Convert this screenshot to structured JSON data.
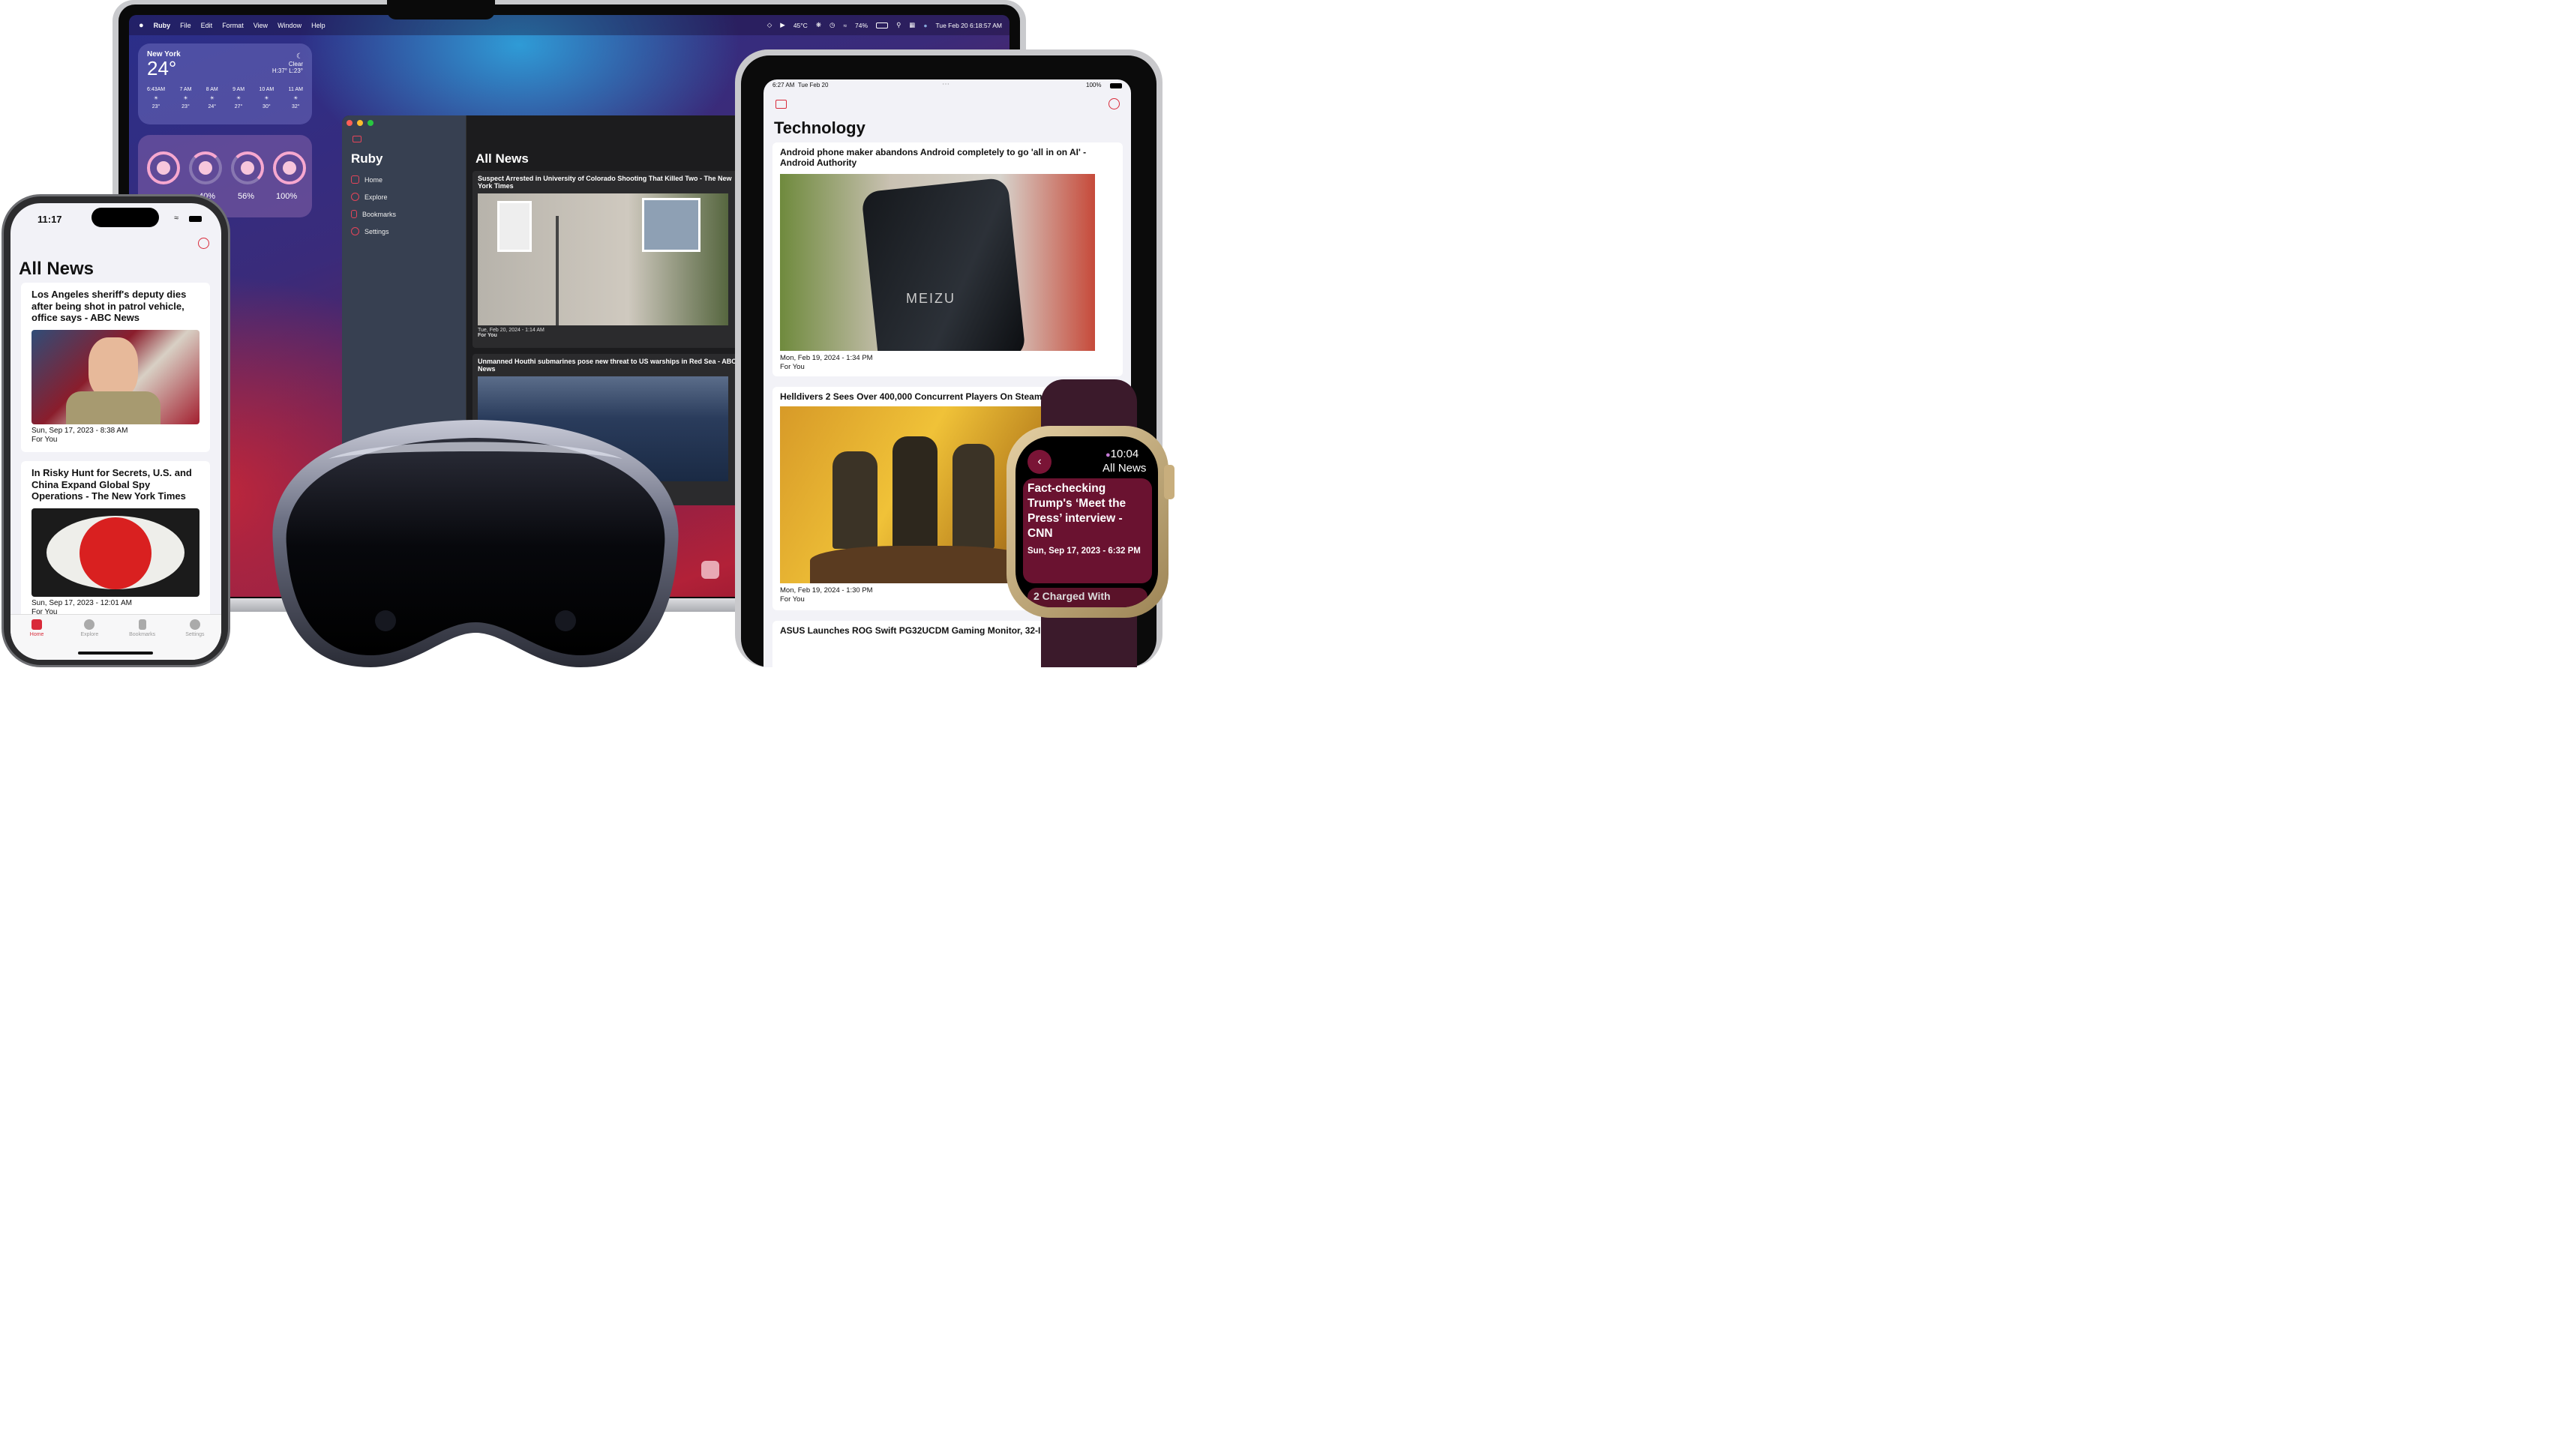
{
  "colors": {
    "brand_red": "#d92b3a",
    "mac_sidebar_accent": "#e6455a",
    "watch_card": "#6a1230"
  },
  "mac": {
    "menu": {
      "apple_icon": "apple-logo-icon",
      "app_name": "Ruby",
      "items": [
        "File",
        "Edit",
        "Format",
        "View",
        "Window",
        "Help"
      ]
    },
    "status": {
      "temperature": "45°C",
      "battery": "74%",
      "datetime": "Tue Feb 20  6:18:57 AM"
    },
    "weather": {
      "city": "New York",
      "temp": "24°",
      "condition": "Clear",
      "hilo": "H:37° L:23°",
      "hours": [
        {
          "time": "6:43AM",
          "temp": "23°"
        },
        {
          "time": "7 AM",
          "temp": "23°"
        },
        {
          "time": "8 AM",
          "temp": "24°"
        },
        {
          "time": "9 AM",
          "temp": "27°"
        },
        {
          "time": "10 AM",
          "temp": "30°"
        },
        {
          "time": "11 AM",
          "temp": "32°"
        }
      ]
    },
    "batteries": {
      "pct_2": "40%",
      "pct_3": "56%",
      "pct_4": "100%"
    },
    "window": {
      "sidebar_title": "Ruby",
      "nav": [
        "Home",
        "Explore",
        "Bookmarks",
        "Settings"
      ],
      "main_title": "All News",
      "articles": [
        {
          "title": "Suspect Arrested in University of Colorado Shooting That Killed Two - The New York Times",
          "date": "Tue, Feb 20, 2024 - 1:14 AM",
          "category": "For You"
        },
        {
          "title": "Unmanned Houthi submarines pose new threat to US warships in Red Sea - ABC News"
        }
      ]
    }
  },
  "iphone": {
    "time": "11:17",
    "title": "All News",
    "articles": [
      {
        "title": "Los Angeles sheriff's deputy dies after being shot in patrol vehicle, office says - ABC News",
        "date": "Sun, Sep 17, 2023 - 8:38 AM",
        "category": "For You"
      },
      {
        "title": "In Risky Hunt for Secrets, U.S. and China Expand Global Spy Operations - The New York Times",
        "date": "Sun, Sep 17, 2023 - 12:01 AM",
        "category": "For You"
      }
    ],
    "tabs": [
      "Home",
      "Explore",
      "Bookmarks",
      "Settings"
    ]
  },
  "ipad": {
    "time": "6:27 AM",
    "date": "Tue Feb 20",
    "battery": "100%",
    "title": "Technology",
    "articles": [
      {
        "title": "Android phone maker abandons Android completely to go 'all in on AI' - Android Authority",
        "image_text": "MEIZU",
        "date": "Mon, Feb 19, 2024 - 1:34 PM",
        "category": "For You"
      },
      {
        "title": "Helldivers 2 Sees Over 400,000 Concurrent Players On Steam",
        "date": "Mon, Feb 19, 2024 - 1:30 PM",
        "category": "For You"
      },
      {
        "title": "ASUS Launches ROG Swift PG32UCDM Gaming Monitor, 32-In"
      }
    ]
  },
  "watch": {
    "time": "10:04",
    "title": "All News",
    "article": {
      "title": "Fact-checking Trump's ‘Meet the Press’ interview - CNN",
      "date": "Sun, Sep 17, 2023 - 6:32 PM"
    },
    "next_article": "2 Charged With"
  }
}
